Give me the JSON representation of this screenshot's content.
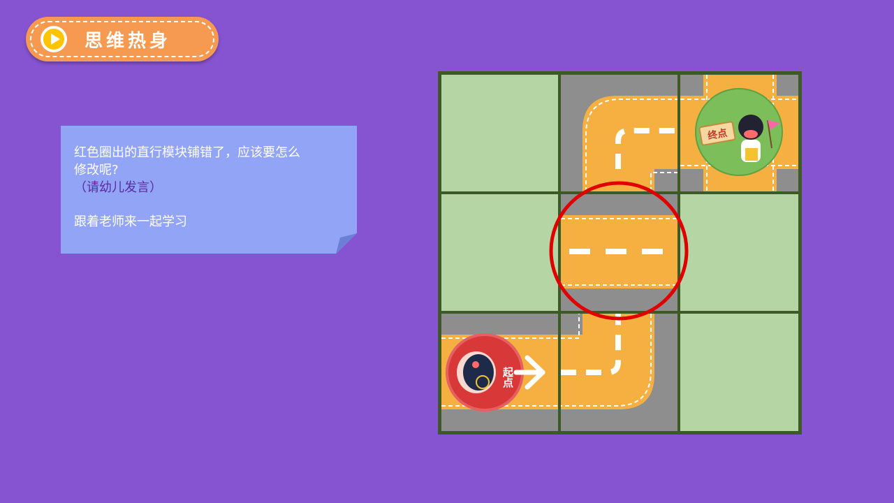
{
  "header": {
    "title": "思维热身",
    "icon": "play-icon",
    "accent_color": "#f59a50"
  },
  "note": {
    "line1": "红色圈出的直行模块铺错了，应该要怎么",
    "line2": "修改呢?",
    "line3": "（请幼儿发言）",
    "line4": "跟着老师来一起学习"
  },
  "puzzle": {
    "start_label": "起点",
    "end_label": "终点",
    "highlight_color": "#e00000",
    "road_color": "#f5b041",
    "grass_color": "#b5d6a4",
    "grid_color": "#3d5a26"
  }
}
